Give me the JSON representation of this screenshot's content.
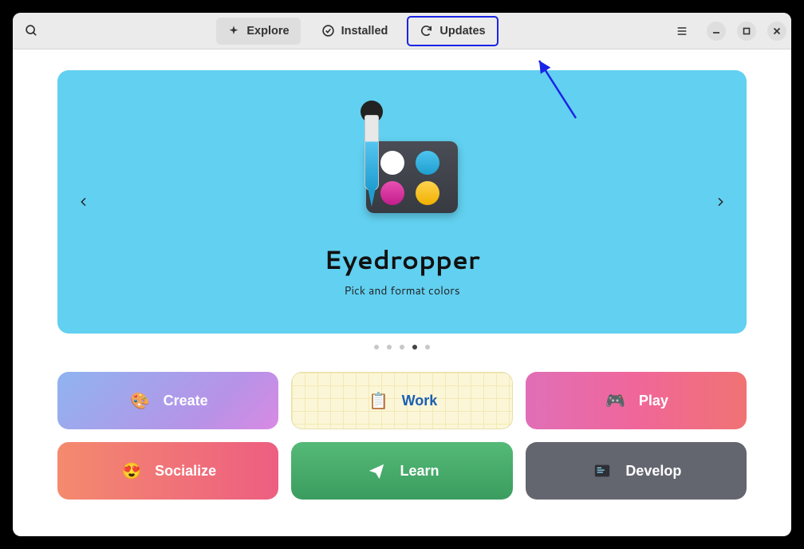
{
  "tabs": {
    "explore": "Explore",
    "installed": "Installed",
    "updates": "Updates"
  },
  "featured": {
    "title": "Eyedropper",
    "subtitle": "Pick and format colors"
  },
  "pagination": {
    "count": 5,
    "active": 3
  },
  "categories": {
    "create": "Create",
    "work": "Work",
    "play": "Play",
    "socialize": "Socialize",
    "learn": "Learn",
    "develop": "Develop"
  }
}
